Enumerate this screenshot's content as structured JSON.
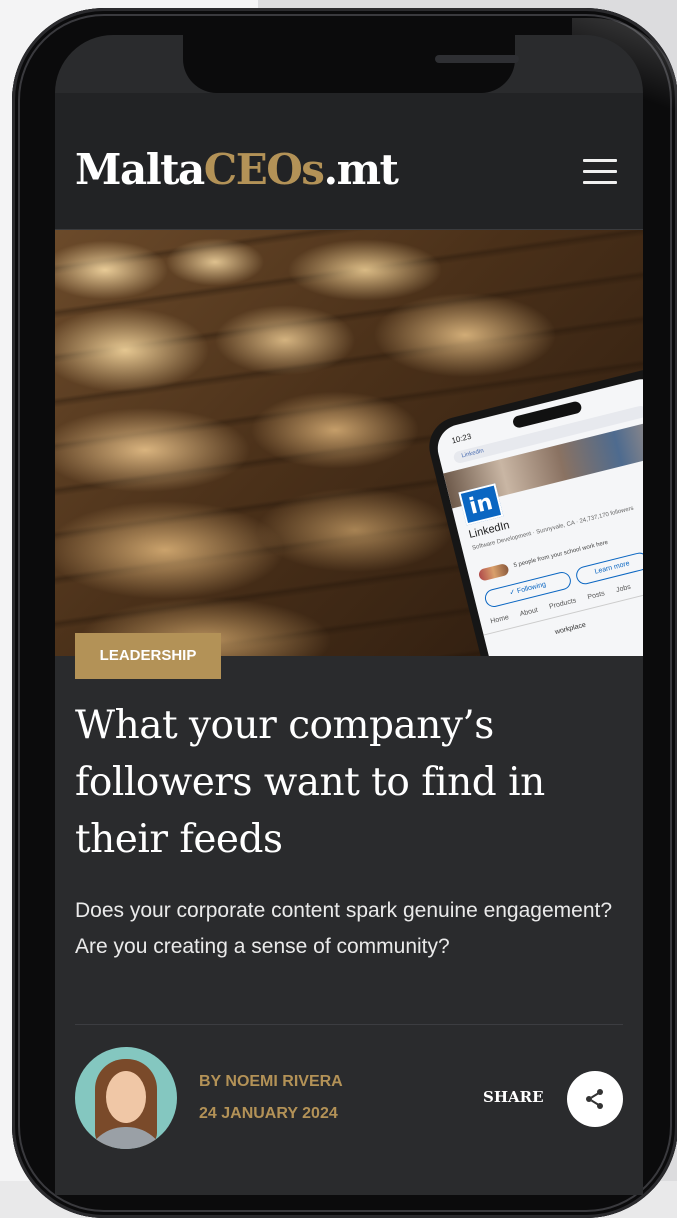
{
  "header": {
    "logo_part1": "Malta",
    "logo_part2": "CEOs",
    "logo_part3": ".mt"
  },
  "hero_photo": {
    "phone_time": "10:23",
    "search_text": "LinkedIn",
    "company_name": "LinkedIn",
    "company_meta": "Software Development · Sunnyvale, CA · 24,737,170 followers",
    "mutuals": "5 people from your school work here",
    "following_button": "✓ Following",
    "learn_more_button": "Learn more",
    "tabs": "Home About Products Posts Jobs",
    "extra": "workplace"
  },
  "article": {
    "category": "LEADERSHIP",
    "title": "What your company’s followers want to find in their feeds",
    "standfirst": "Does your corporate content spark genuine engagement? Are you creating a sense of community?",
    "author": "BY NOEMI RIVERA",
    "date": "24 JANUARY 2024",
    "share_label": "SHARE"
  },
  "colors": {
    "accent_gold": "#b39257",
    "background_dark": "#2a2b2d",
    "header_dark": "#222325",
    "linkedin_blue": "#0a66c2"
  },
  "icons": {
    "menu": "hamburger-icon",
    "share": "share-icon"
  }
}
